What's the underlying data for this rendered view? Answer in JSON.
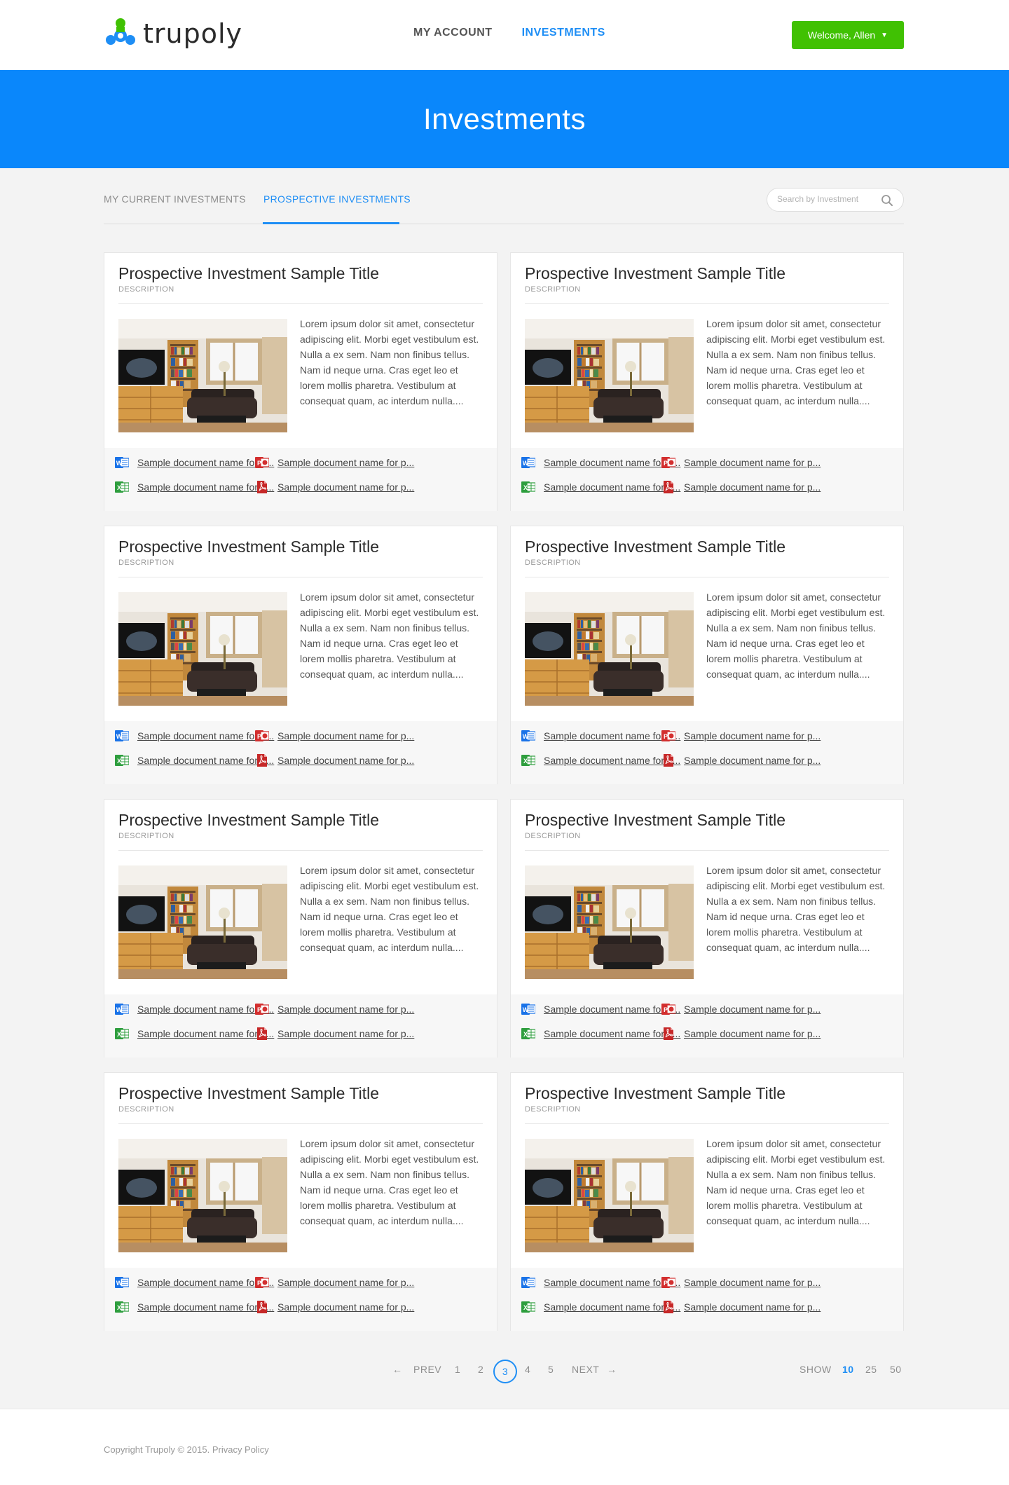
{
  "header": {
    "logo_text": "trupoly",
    "nav": [
      {
        "label": "MY ACCOUNT",
        "active": false
      },
      {
        "label": "INVESTMENTS",
        "active": true
      }
    ],
    "welcome_label": "Welcome, Allen",
    "brand_color": "#40c103"
  },
  "banner": {
    "title": "Investments",
    "color": "#0a87fb"
  },
  "tabs": {
    "current": "MY CURRENT INVESTMENTS",
    "prospective": "PROSPECTIVE INVESTMENTS",
    "active": "prospective"
  },
  "search": {
    "placeholder": "Search by Investment",
    "icon": "search-icon"
  },
  "cards": [
    {
      "title": "Prospective Investment Sample Title",
      "description": "DESCRIPTION",
      "text": "Lorem ipsum dolor sit amet, consectetur adipiscing elit. Morbi eget vestibulum est. Nulla a ex sem. Nam non finibus tellus. Nam id neque urna. Cras eget leo et lorem mollis pharetra. Vestibulum at consequat quam, ac interdum nulla....",
      "docs": [
        "Sample document name for p...",
        "Sample document name for p...",
        "Sample document name for p...",
        "Sample document name for p..."
      ]
    },
    {
      "title": "Prospective Investment Sample Title",
      "description": "DESCRIPTION",
      "text": "Lorem ipsum dolor sit amet, consectetur adipiscing elit. Morbi eget vestibulum est. Nulla a ex sem. Nam non finibus tellus. Nam id neque urna. Cras eget leo et lorem mollis pharetra. Vestibulum at consequat quam, ac interdum nulla....",
      "docs": [
        "Sample document name for p...",
        "Sample document name for p...",
        "Sample document name for p...",
        "Sample document name for p..."
      ]
    },
    {
      "title": "Prospective Investment Sample Title",
      "description": "DESCRIPTION",
      "text": "Lorem ipsum dolor sit amet, consectetur adipiscing elit. Morbi eget vestibulum est. Nulla a ex sem. Nam non finibus tellus. Nam id neque urna. Cras eget leo et lorem mollis pharetra. Vestibulum at consequat quam, ac interdum nulla....",
      "docs": [
        "Sample document name for p...",
        "Sample document name for p...",
        "Sample document name for p...",
        "Sample document name for p..."
      ]
    },
    {
      "title": "Prospective Investment Sample Title",
      "description": "DESCRIPTION",
      "text": "Lorem ipsum dolor sit amet, consectetur adipiscing elit. Morbi eget vestibulum est. Nulla a ex sem. Nam non finibus tellus. Nam id neque urna. Cras eget leo et lorem mollis pharetra. Vestibulum at consequat quam, ac interdum nulla....",
      "docs": [
        "Sample document name for p...",
        "Sample document name for p...",
        "Sample document name for p...",
        "Sample document name for p..."
      ]
    },
    {
      "title": "Prospective Investment Sample Title",
      "description": "DESCRIPTION",
      "text": "Lorem ipsum dolor sit amet, consectetur adipiscing elit. Morbi eget vestibulum est. Nulla a ex sem. Nam non finibus tellus. Nam id neque urna. Cras eget leo et lorem mollis pharetra. Vestibulum at consequat quam, ac interdum nulla....",
      "docs": [
        "Sample document name for p...",
        "Sample document name for p...",
        "Sample document name for p...",
        "Sample document name for p..."
      ]
    },
    {
      "title": "Prospective Investment Sample Title",
      "description": "DESCRIPTION",
      "text": "Lorem ipsum dolor sit amet, consectetur adipiscing elit. Morbi eget vestibulum est. Nulla a ex sem. Nam non finibus tellus. Nam id neque urna. Cras eget leo et lorem mollis pharetra. Vestibulum at consequat quam, ac interdum nulla....",
      "docs": [
        "Sample document name for p...",
        "Sample document name for p...",
        "Sample document name for p...",
        "Sample document name for p..."
      ]
    },
    {
      "title": "Prospective Investment Sample Title",
      "description": "DESCRIPTION",
      "text": "Lorem ipsum dolor sit amet, consectetur adipiscing elit. Morbi eget vestibulum est. Nulla a ex sem. Nam non finibus tellus. Nam id neque urna. Cras eget leo et lorem mollis pharetra. Vestibulum at consequat quam, ac interdum nulla....",
      "docs": [
        "Sample document name for p...",
        "Sample document name for p...",
        "Sample document name for p...",
        "Sample document name for p..."
      ]
    },
    {
      "title": "Prospective Investment Sample Title",
      "description": "DESCRIPTION",
      "text": "Lorem ipsum dolor sit amet, consectetur adipiscing elit. Morbi eget vestibulum est. Nulla a ex sem. Nam non finibus tellus. Nam id neque urna. Cras eget leo et lorem mollis pharetra. Vestibulum at consequat quam, ac interdum nulla....",
      "docs": [
        "Sample document name for p...",
        "Sample document name for p...",
        "Sample document name for p...",
        "Sample document name for p..."
      ]
    }
  ],
  "doc_types": [
    "word-doc-icon",
    "powerpoint-doc-icon",
    "excel-doc-icon",
    "pdf-doc-icon"
  ],
  "doc_colors": {
    "word": "#1a73e8",
    "powerpoint": "#d32f2f",
    "excel": "#2e9e3e",
    "pdf": "#c62828"
  },
  "pagination": {
    "prev": "PREV",
    "next": "NEXT",
    "prev_arrow": "←",
    "next_arrow": "→",
    "pages": [
      "1",
      "2",
      "3",
      "4",
      "5"
    ],
    "current": "3",
    "show_label": "SHOW",
    "sizes": [
      "10",
      "25",
      "50"
    ],
    "active_size": "10"
  },
  "footer": {
    "copyright": "Copyright Trupoly © 2015. Privacy Policy"
  }
}
